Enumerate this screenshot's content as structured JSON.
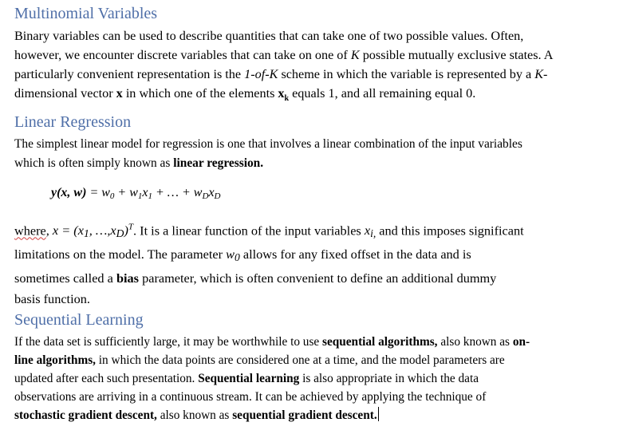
{
  "sections": {
    "multinomial": {
      "title": "Multinomial Variables",
      "p1": "Binary variables can be used to describe quantities that can take one of two possible values. Often,",
      "p2a": "however, we encounter discrete variables that can take on one of ",
      "p2k": "K",
      "p2b": " possible mutually exclusive states. A",
      "p3a": "particularly convenient representation is the ",
      "p3i": "1-of-K",
      "p3b": " scheme in which the variable is represented by a ",
      "p3k": "K-",
      "p4a": "dimensional vector ",
      "p4x": "x",
      "p4b": " in which one of the elements ",
      "p4xk": "x",
      "p4k": "k",
      "p4c": " equals 1, and all remaining equal 0."
    },
    "linear": {
      "title": "Linear Regression",
      "p1": "The simplest linear model for regression is one that involves a linear combination of the input variables",
      "p2a": "which is often simply known as ",
      "p2b": "linear regression.",
      "formula": {
        "lhs": "y(x, w)",
        "eq": " = w",
        "s0": "0",
        "p1": " + w",
        "s1": "1",
        "x1": "x",
        "s1b": "1",
        "mid": " + … + w",
        "sD": "D",
        "xD": "x",
        "sD2": "D"
      },
      "w1": "where",
      "w2": ", x = (x",
      "w2s": "1",
      "w3": ", …,x",
      "w3s": "D",
      "w4": ")",
      "w4t": "T",
      "w5": ". It is a linear function of the input variables ",
      "w5x": "x",
      "w5i": "i,",
      "w6": " and this imposes significant",
      "l2a": "limitations on the model. The parameter ",
      "l2w": "w",
      "l2s": "0",
      "l2b": " allows for any fixed offset in the data and is",
      "l3a": "sometimes called a ",
      "l3b": "bias",
      "l3c": " parameter,  which is often convenient to define an additional dummy",
      "l4": "basis function."
    },
    "sequential": {
      "title": "Sequential Learning",
      "l1a": "If the data set is sufficiently large, it may be worthwhile to use ",
      "l1b": "sequential algorithms,",
      "l1c": " also known as ",
      "l1d": "on-",
      "l2a": "line algorithms,",
      "l2b": " in which the data points are considered one at a time, and the model parameters are",
      "l3": "updated after each such presentation. ",
      "l3b": "Sequential learning",
      "l3c": " is also appropriate in which the data",
      "l4": "observations are arriving in a continuous stream. It can be achieved by applying the technique of",
      "l5a": "stochastic gradient descent,",
      "l5b": " also known as ",
      "l5c": "sequential gradient descent."
    }
  }
}
